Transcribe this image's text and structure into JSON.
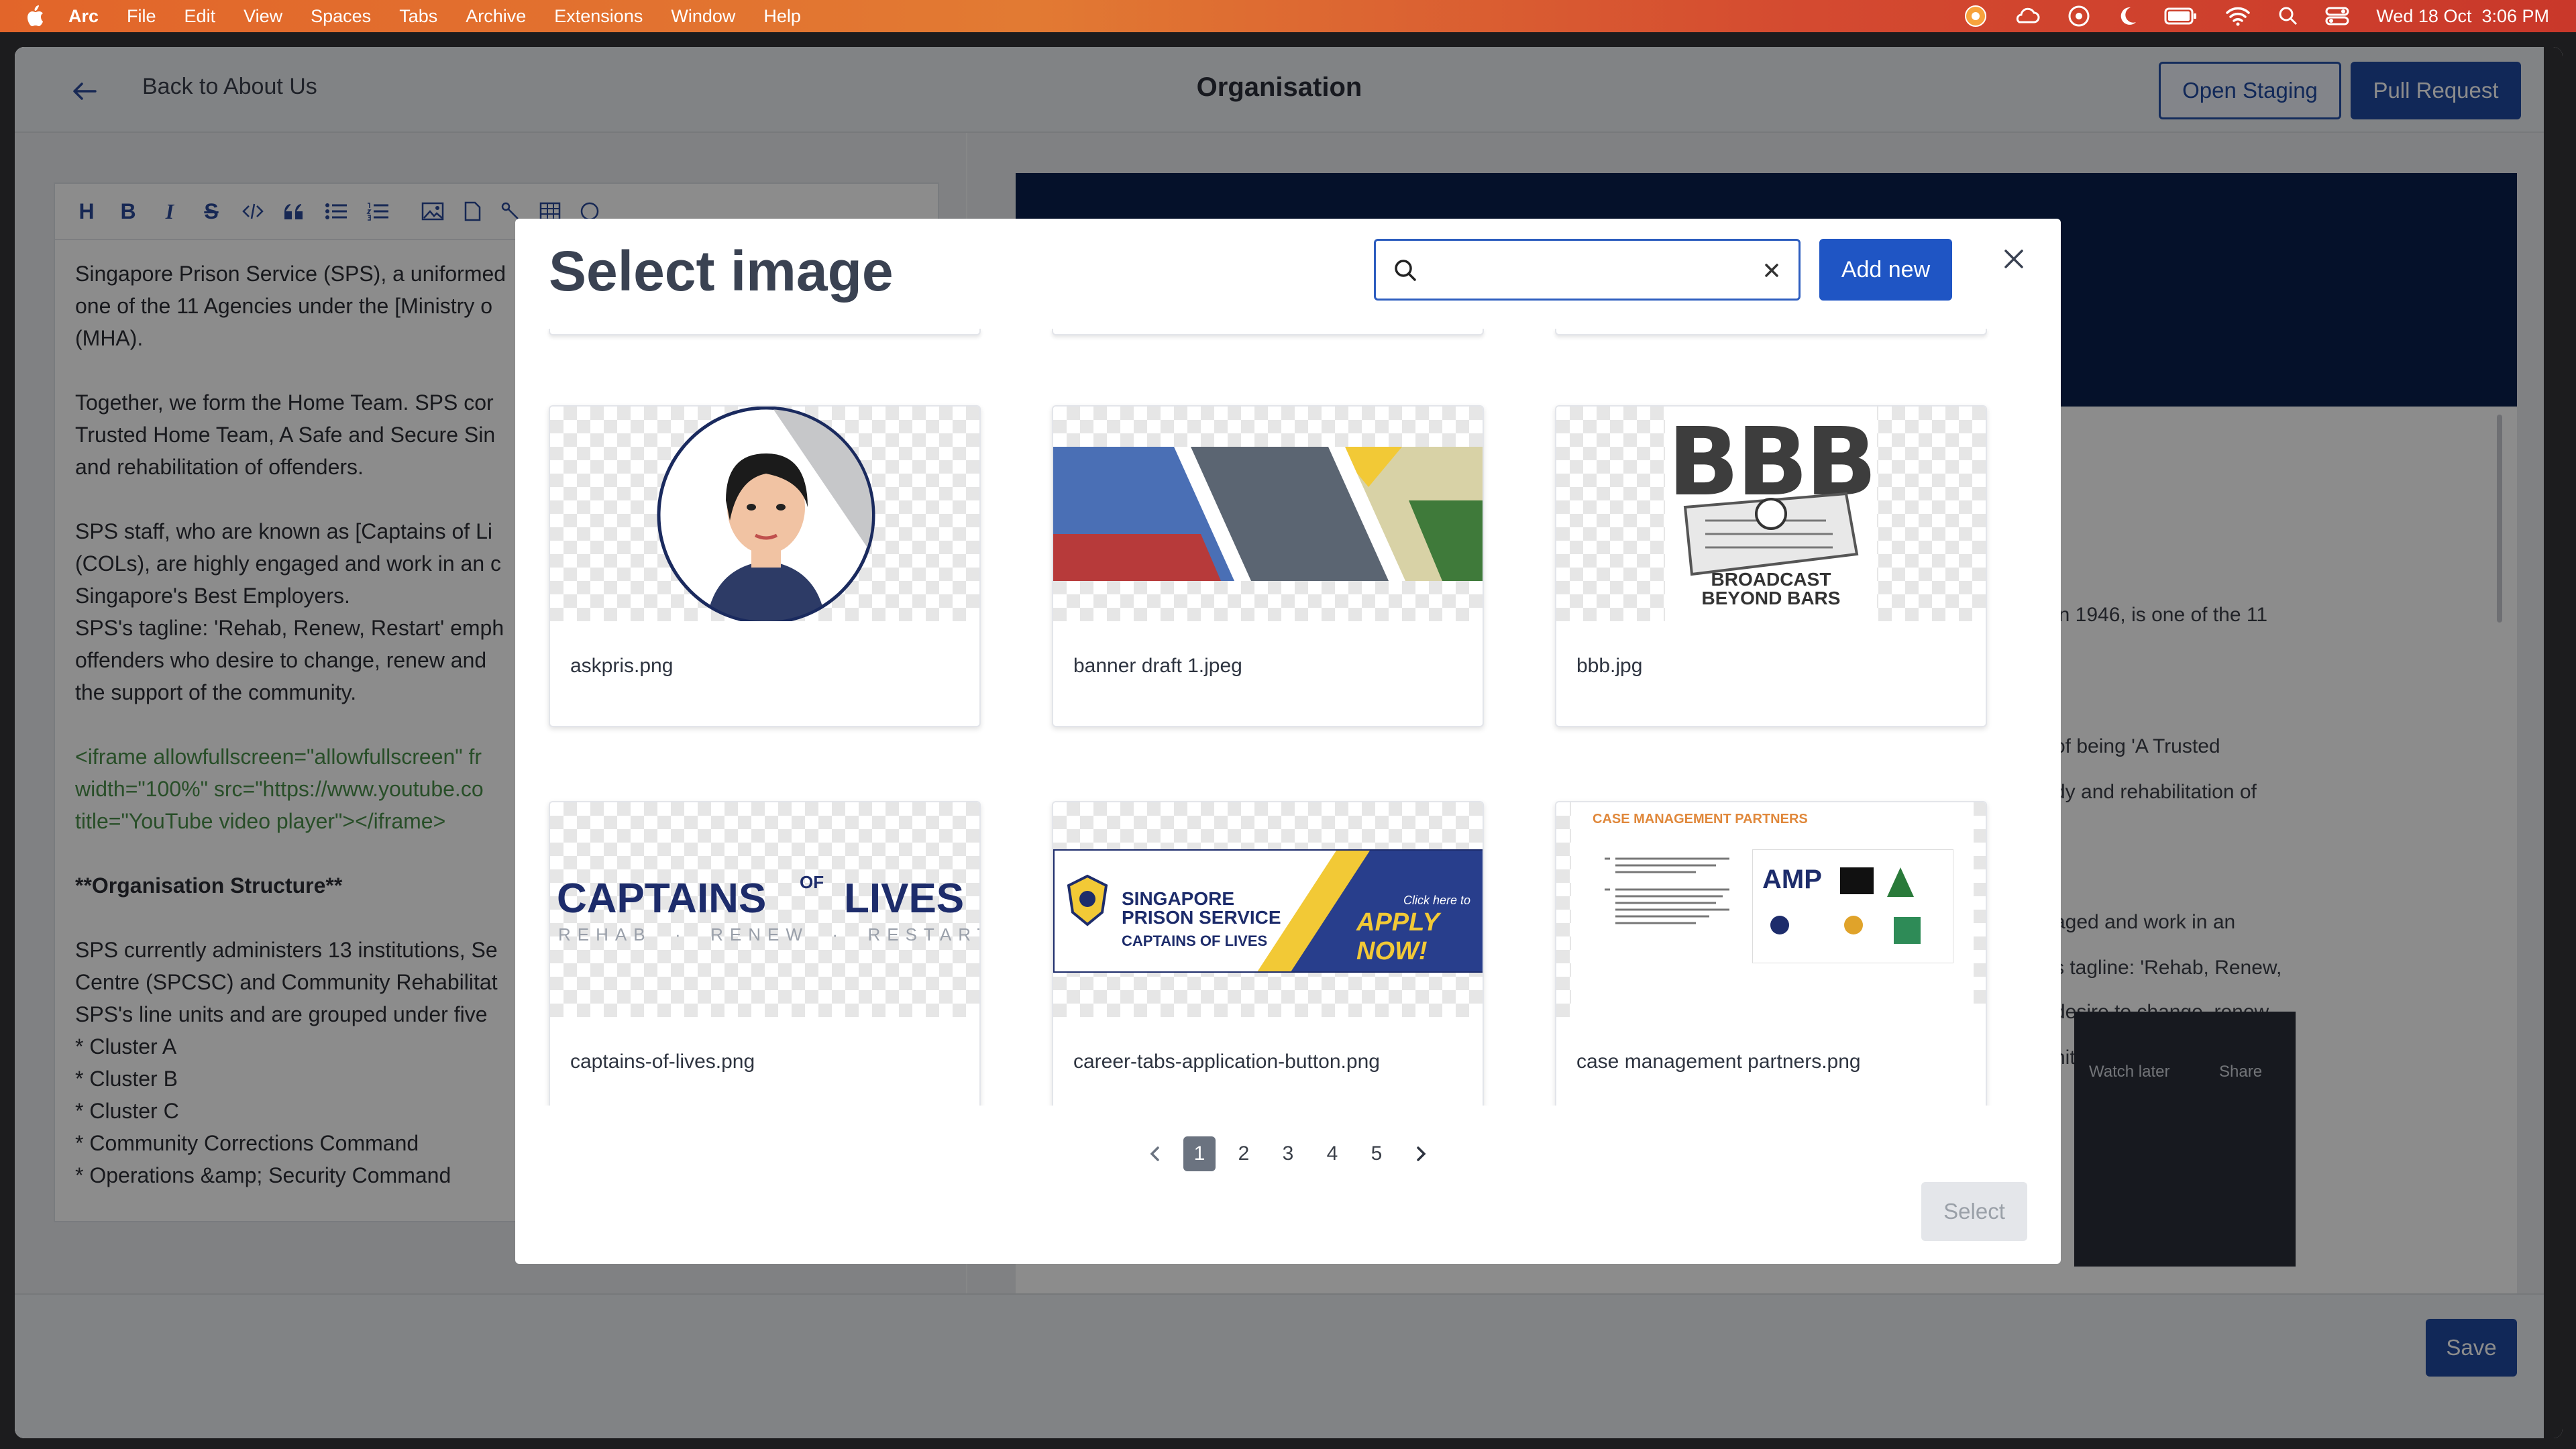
{
  "menubar": {
    "app": "Arc",
    "items": [
      "File",
      "Edit",
      "View",
      "Spaces",
      "Tabs",
      "Archive",
      "Extensions",
      "Window",
      "Help"
    ],
    "datetime": "Wed 18 Oct  3:06 PM",
    "icons": [
      "apple-icon",
      "arc-icon",
      "weather-icon",
      "focus-icon",
      "moon-icon",
      "battery-icon",
      "wifi-icon",
      "spotlight-icon",
      "control-center-icon"
    ]
  },
  "header": {
    "back_label": "Back to About Us",
    "title": "Organisation",
    "open_staging": "Open Staging",
    "pull_request": "Pull Request"
  },
  "toolbar": {
    "tools": [
      "H",
      "B",
      "I",
      "S"
    ]
  },
  "editor": {
    "p1_a": "Singapore Prison Service (SPS), a uniformed",
    "p1_b": "one of the 11 Agencies under the [Ministry o",
    "p1_c": "(MHA).",
    "p2_a": "Together, we form the Home Team. SPS cor",
    "p2_b": "Trusted Home Team, A Safe and Secure Sin",
    "p2_c": "and rehabilitation of offenders.",
    "p3_a": "SPS staff, who are known as [Captains of Li",
    "p3_b": "(COLs), are highly engaged and work in an c",
    "p3_c": "Singapore's Best Employers.",
    "p3_d": "SPS's tagline: 'Rehab, Renew, Restart' emph",
    "p3_e": "offenders who desire to change, renew and",
    "p3_f": "the support of the community.",
    "p4_a": "<iframe allowfullscreen=\"allowfullscreen\" fr",
    "p4_b": "width=\"100%\" src=\"https://www.youtube.co",
    "p4_c": "title=\"YouTube video player\"></iframe>",
    "p5": "**Organisation Structure**",
    "p6_a": "SPS currently administers 13 institutions, Se",
    "p6_b": "Centre (SPCSC) and Community Rehabilitat",
    "p6_c": "SPS's line units and are grouped under five",
    "list": [
      "* Cluster A",
      "* Cluster B",
      "* Cluster C",
      "* Community Corrections Command",
      "* Operations &amp; Security Command"
    ]
  },
  "preview": {
    "lines": [
      "in 1946, is one of the 11",
      "of being 'A Trusted",
      "dy and rehabilitation of",
      "aged and work in an",
      "s tagline: 'Rehab, Renew,",
      "desire to change, renew",
      "nity."
    ],
    "video_watch_later": "Watch later",
    "video_share": "Share"
  },
  "save_label": "Save",
  "modal": {
    "title": "Select image",
    "search_value": "",
    "add_new": "Add new",
    "select_label": "Select",
    "images": [
      {
        "name": "askpris.png"
      },
      {
        "name": "banner draft 1.jpeg"
      },
      {
        "name": "bbb.jpg",
        "logo_text": "BBB",
        "caption": "BROADCAST BEYOND BARS"
      },
      {
        "name": "captains-of-lives.png",
        "logo_main_a": "CAPTAINS",
        "logo_of": "OF",
        "logo_main_b": "LIVES",
        "logo_sub": "REHAB  ·  RENEW  ·  RESTART"
      },
      {
        "name": "career-tabs-application-button.png",
        "line1": "SINGAPORE",
        "line2": "PRISON SERVICE",
        "line3": "CAPTAINS OF LIVES",
        "cta_small": "Click here to",
        "cta": "APPLY NOW!"
      },
      {
        "name": "case management partners.png",
        "heading": "CASE MANAGEMENT PARTNERS",
        "partner1": "AMP"
      }
    ],
    "pages": [
      "1",
      "2",
      "3",
      "4",
      "5"
    ],
    "active_page": "1"
  }
}
